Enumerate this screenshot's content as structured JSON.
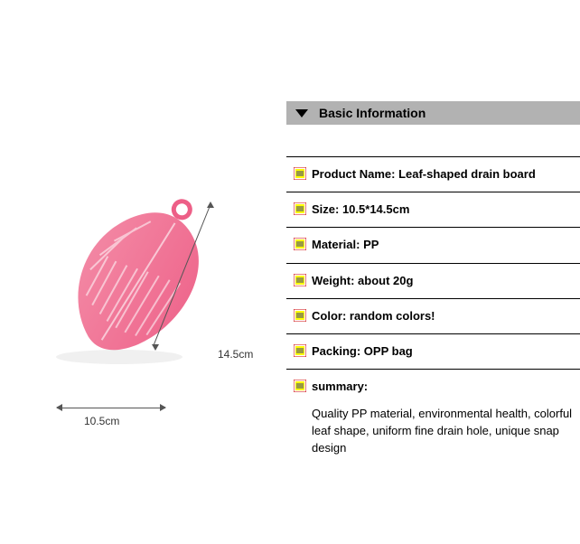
{
  "header": {
    "title": "Basic Information"
  },
  "rows": [
    {
      "label": "Product Name: Leaf-shaped drain board"
    },
    {
      "label": "Size: 10.5*14.5cm"
    },
    {
      "label": " Material:  PP"
    },
    {
      "label": "Weight: about 20g"
    },
    {
      "label": "Color: random colors!"
    },
    {
      "label": "Packing: OPP bag"
    }
  ],
  "summary": {
    "title": "summary:",
    "body": "Quality PP material, environmental health,  colorful leaf shape, uniform fine drain hole, unique snap design"
  },
  "dims": {
    "width_label": "10.5cm",
    "height_label": "14.5cm"
  }
}
